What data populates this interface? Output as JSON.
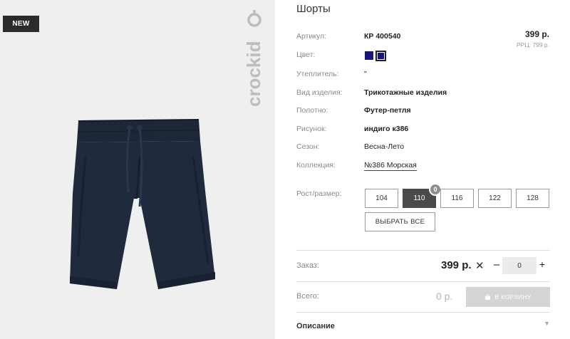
{
  "product": {
    "badge": "NEW",
    "brand": "crockid",
    "title": "Шорты",
    "price": "399 р.",
    "rrp": "РРЦ: 799 р."
  },
  "specs": [
    {
      "label": "Артикул:",
      "value": "КР 400540"
    },
    {
      "label": "Цвет:",
      "value": ""
    },
    {
      "label": "Утеплитель:",
      "value": "\""
    },
    {
      "label": "Вид изделия:",
      "value": "Трикотажные изделия"
    },
    {
      "label": "Полотно:",
      "value": "Футер-петля"
    },
    {
      "label": "Рисунок:",
      "value": "индиго к386"
    },
    {
      "label": "Сезон:",
      "value": "Весна-Лето"
    },
    {
      "label": "Коллекция:",
      "value": "№386 Морская"
    }
  ],
  "colors": {
    "swatch": "#15157a",
    "active_size": "#4a4a4a"
  },
  "sizes": {
    "label": "Рост/размер:",
    "options": [
      "104",
      "110",
      "116",
      "122",
      "128"
    ],
    "selected": "110",
    "selected_count": "0",
    "select_all": "ВЫБРАТЬ ВСЕ"
  },
  "order": {
    "label": "Заказ:",
    "price": "399 р.",
    "times": "✕",
    "minus": "–",
    "quantity": "0",
    "plus": "+"
  },
  "total": {
    "label": "Всего:",
    "value": "0 р.",
    "cart_button": "В КОРЗИНУ"
  },
  "description": {
    "label": "Описание"
  }
}
